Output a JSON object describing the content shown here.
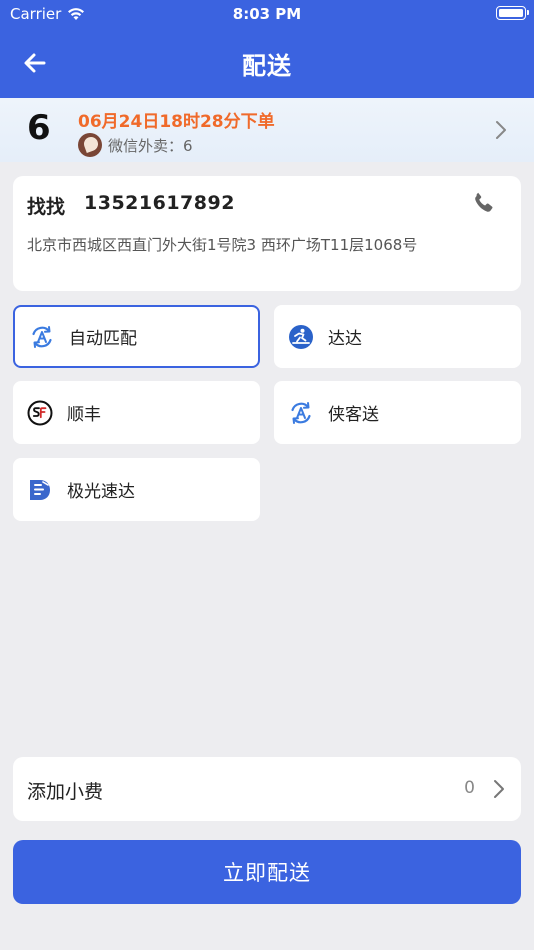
{
  "status_bar": {
    "carrier": "Carrier",
    "time": "8:03 PM"
  },
  "navbar": {
    "title": "配送"
  },
  "order": {
    "number": "6",
    "time": "06月24日18时28分下单",
    "source": "微信外卖：6"
  },
  "address": {
    "name": "找找",
    "phone": "13521617892",
    "address": "北京市西城区西直门外大街1号院3 西环广场T11层1068号"
  },
  "services": [
    {
      "label": "自动匹配",
      "icon": "auto-match-icon",
      "selected": true
    },
    {
      "label": "达达",
      "icon": "dada-icon",
      "selected": false
    },
    {
      "label": "顺丰",
      "icon": "sf-express-icon",
      "selected": false
    },
    {
      "label": "侠客送",
      "icon": "xiakesong-icon",
      "selected": false
    },
    {
      "label": "极光速达",
      "icon": "jiguang-icon",
      "selected": false
    }
  ],
  "tip": {
    "label": "添加小费",
    "value": "0"
  },
  "submit": {
    "label": "立即配送"
  },
  "colors": {
    "accent": "#3b63e0",
    "order_time": "#f06a2a"
  }
}
